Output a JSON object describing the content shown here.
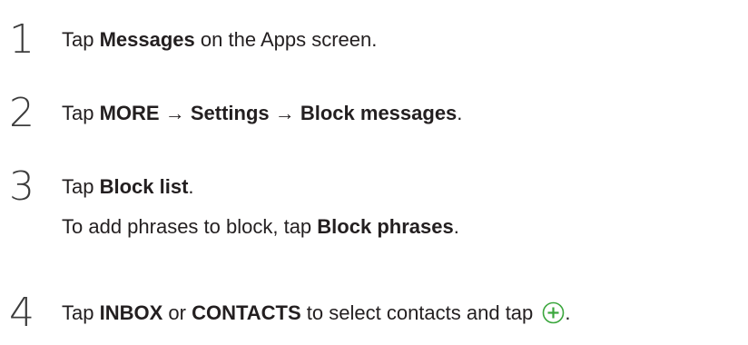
{
  "steps": [
    {
      "number": "1",
      "parts": [
        "Tap ",
        "Messages",
        " on the Apps screen."
      ]
    },
    {
      "number": "2",
      "parts": [
        "Tap ",
        "MORE",
        " → ",
        "Settings",
        " → ",
        "Block messages",
        "."
      ]
    },
    {
      "number": "3",
      "parts": [
        "Tap ",
        "Block list",
        "."
      ],
      "note_parts": [
        "To add phrases to block, tap ",
        "Block phrases",
        "."
      ]
    },
    {
      "number": "4",
      "parts": [
        "Tap ",
        "INBOX",
        " or ",
        "CONTACTS",
        " to select contacts and tap ",
        "."
      ]
    }
  ],
  "icons": {
    "add": "plus-circle-icon"
  },
  "colors": {
    "text": "#231f20",
    "icon_green": "#3aa63c"
  }
}
